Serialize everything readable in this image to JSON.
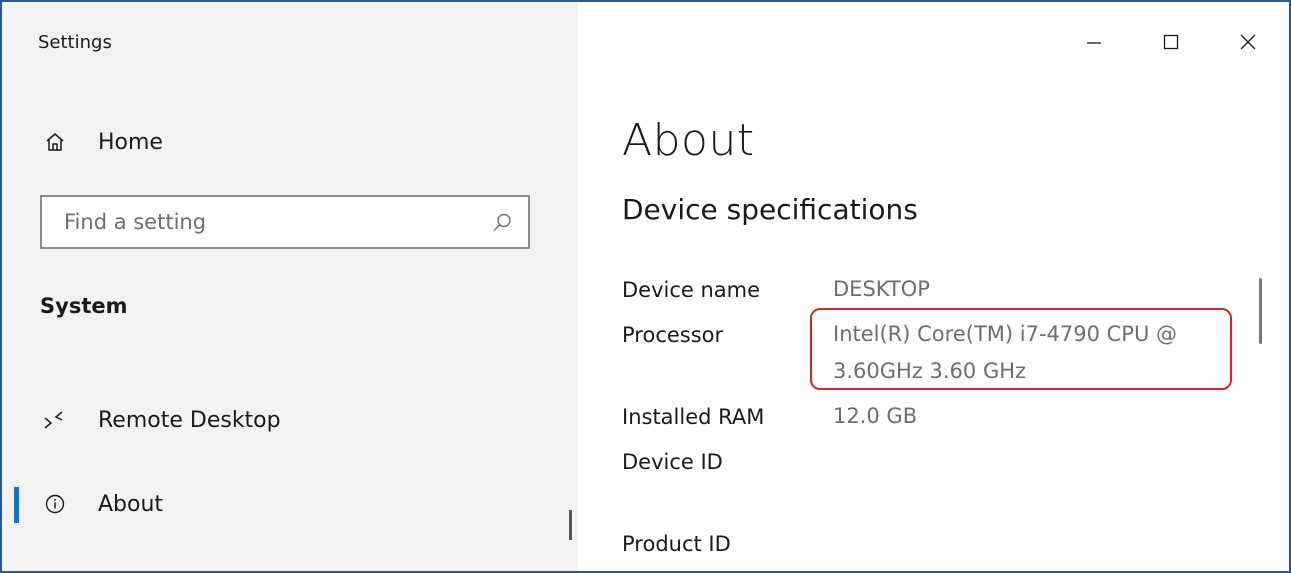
{
  "window": {
    "app_title": "Settings"
  },
  "sidebar": {
    "home_label": "Home",
    "search": {
      "placeholder": "Find a setting"
    },
    "section_label": "System",
    "items": [
      {
        "label": "Remote Desktop",
        "icon": "remote-desktop-icon"
      },
      {
        "label": "About",
        "icon": "info-icon",
        "selected": true
      }
    ]
  },
  "main": {
    "title": "About",
    "subtitle": "Device specifications",
    "specs": {
      "device_name": {
        "label": "Device name",
        "value": "DESKTOP"
      },
      "processor": {
        "label": "Processor",
        "value_line1": "Intel(R) Core(TM) i7-4790 CPU @",
        "value_line2": "3.60GHz   3.60 GHz"
      },
      "ram": {
        "label": "Installed RAM",
        "value": "12.0 GB"
      },
      "device_id": {
        "label": "Device ID"
      },
      "product_id": {
        "label": "Product ID"
      }
    }
  },
  "colors": {
    "accent": "#0078d7",
    "highlight": "#d9252f",
    "sidebar_bg": "#f2f2f2"
  },
  "icons": [
    "home-icon",
    "search-icon",
    "remote-desktop-icon",
    "info-icon",
    "minimize-icon",
    "maximize-icon",
    "close-icon"
  ]
}
